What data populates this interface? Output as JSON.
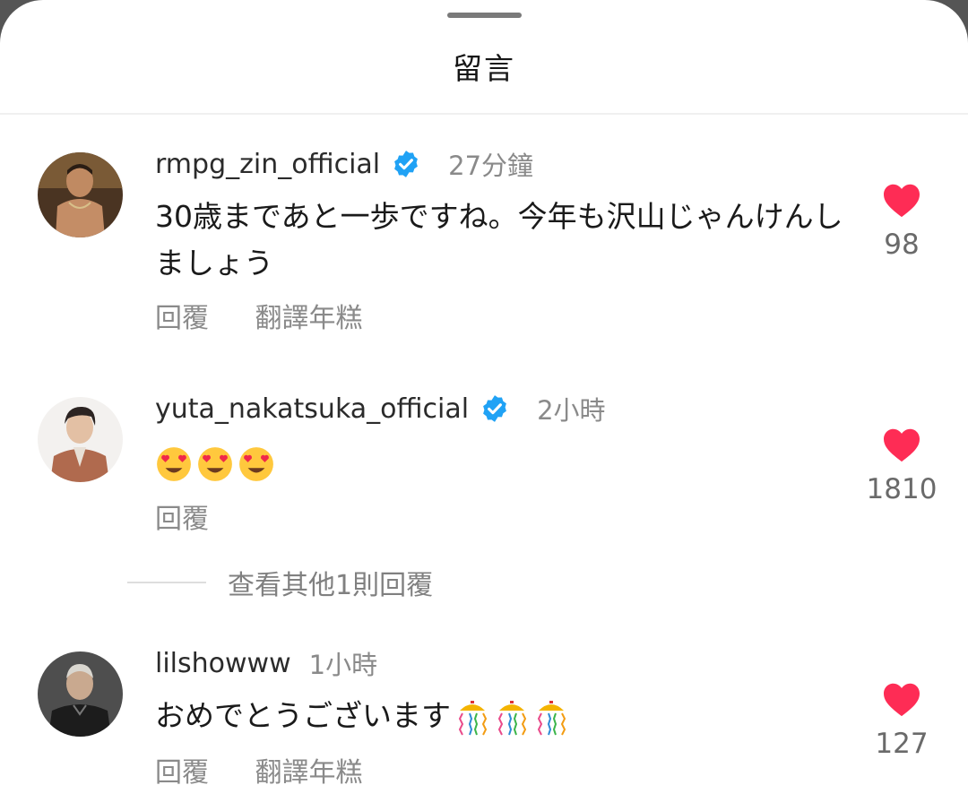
{
  "header": {
    "title": "留言"
  },
  "comments": [
    {
      "username": "rmpg_zin_official",
      "verified": true,
      "timestamp": "27分鐘",
      "text": "30歳まであと一歩ですね。今年も沢山じゃんけんしましょう",
      "reply_label": "回覆",
      "translate_label": "翻譯年糕",
      "likes": "98"
    },
    {
      "username": "yuta_nakatsuka_official",
      "verified": true,
      "timestamp": "2小時",
      "text": "",
      "emoji": [
        "😍",
        "😍",
        "😍"
      ],
      "reply_label": "回覆",
      "likes": "1810"
    },
    {
      "username": "lilshowww",
      "verified": false,
      "timestamp": "1小時",
      "text": "おめでとうございます",
      "emoji": [
        "🎊",
        "🎊",
        "🎊"
      ],
      "reply_label": "回覆",
      "translate_label": "翻譯年糕",
      "likes": "127"
    }
  ],
  "view_more_replies": "查看其他1則回覆",
  "colors": {
    "like": "#fe2c55",
    "verified": "#20a2f5",
    "muted": "#8a8a8a"
  },
  "icons": [
    "verified-badge-icon",
    "heart-icon",
    "heart-eyes-emoji",
    "confetti-emoji"
  ]
}
